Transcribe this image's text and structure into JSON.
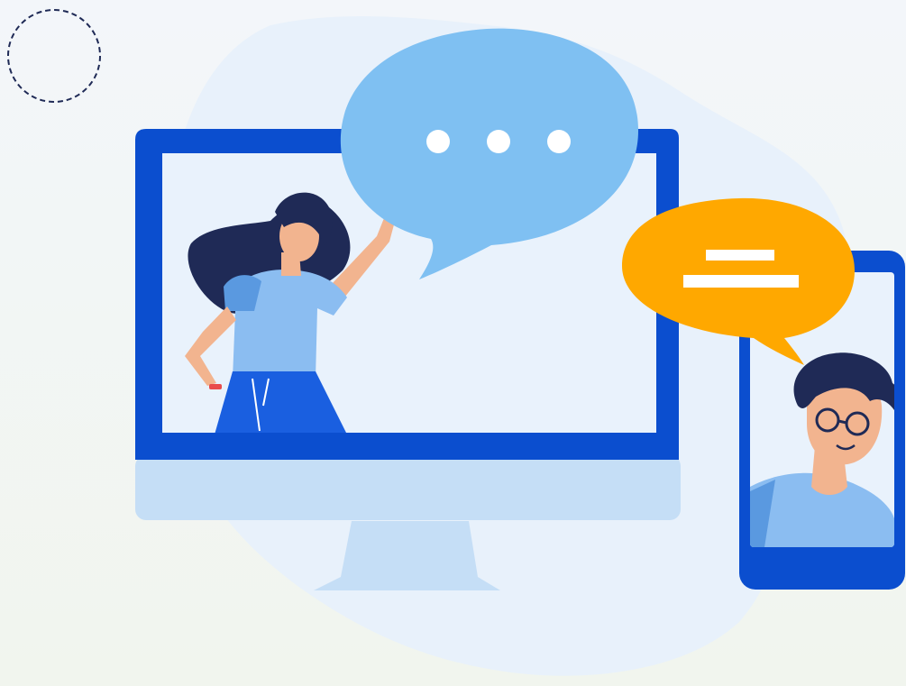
{
  "illustration": {
    "subject": "video-call-illustration",
    "elements": [
      "dashed-circle-decoration",
      "background-blob",
      "desktop-monitor",
      "woman-waving",
      "typing-speech-bubble",
      "smartphone",
      "man-with-glasses",
      "message-speech-bubble"
    ]
  },
  "colors": {
    "page_bg_top": "#f3f6fa",
    "page_bg_bottom": "#f1f5ee",
    "blob": "#e8f1fb",
    "device_blue": "#0b4ecf",
    "screen": "#e9f2fc",
    "stand": "#c5def6",
    "bubble_blue": "#7fc0f2",
    "bubble_orange": "#ffa800",
    "dots": "#ffffff",
    "hair": "#1f2a56",
    "skin": "#f2b48f",
    "shirt_light": "#8bbdf1",
    "shirt_dark": "#5a99e0",
    "skirt": "#1a5fe0",
    "dashed_circle": "#1f2a56"
  }
}
